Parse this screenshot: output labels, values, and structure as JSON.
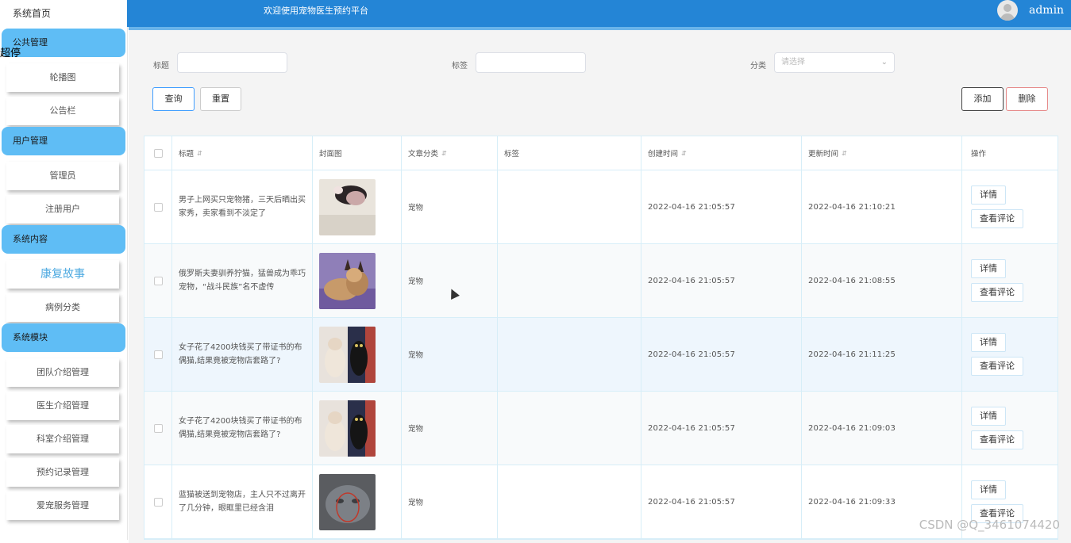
{
  "sidebar": {
    "home": "系统首页",
    "stray_text": "超停",
    "groups": [
      {
        "label": "公共管理",
        "items": [
          "轮播图",
          "公告栏"
        ]
      },
      {
        "label": "用户管理",
        "items": [
          "管理员",
          "注册用户"
        ]
      },
      {
        "label": "系统内容",
        "items": [
          "康复故事",
          "病例分类"
        ]
      },
      {
        "label": "系统模块",
        "items": [
          "团队介绍管理",
          "医生介绍管理",
          "科室介绍管理",
          "预约记录管理",
          "爱宠服务管理"
        ]
      }
    ]
  },
  "header": {
    "title": "欢迎使用宠物医生预约平台",
    "username": "admin"
  },
  "filters": {
    "title_label": "标题",
    "tag_label": "标签",
    "category_label": "分类",
    "category_placeholder": "请选择",
    "query_button": "查询",
    "reset_button": "重置",
    "add_button": "添加",
    "delete_button": "删除"
  },
  "table": {
    "headers": [
      "标题",
      "封面图",
      "文章分类",
      "标签",
      "创建时间",
      "更新时间",
      "操作"
    ],
    "rows": [
      {
        "title": "男子上网买只宠物猪，三天后晒出买家秀，卖家看到不淡定了",
        "category": "宠物",
        "tag": "",
        "created": "2022-04-16 21:05:57",
        "updated": "2022-04-16 21:10:21",
        "thumb": "pig"
      },
      {
        "title": "俄罗斯夫妻驯养狞猫，猛兽成为乖巧宠物，“战斗民族”名不虚传",
        "category": "宠物",
        "tag": "",
        "created": "2022-04-16 21:05:57",
        "updated": "2022-04-16 21:08:55",
        "thumb": "caracal"
      },
      {
        "title": "女子花了4200块钱买了带证书的布偶猫,结果竟被宠物店套路了?",
        "category": "宠物",
        "tag": "",
        "created": "2022-04-16 21:05:57",
        "updated": "2022-04-16 21:11:25",
        "thumb": "ragdoll"
      },
      {
        "title": "女子花了4200块钱买了带证书的布偶猫,结果竟被宠物店套路了?",
        "category": "宠物",
        "tag": "",
        "created": "2022-04-16 21:05:57",
        "updated": "2022-04-16 21:09:03",
        "thumb": "ragdoll"
      },
      {
        "title": "蓝猫被送到宠物店，主人只不过离开了几分钟，眼眶里已经含泪",
        "category": "宠物",
        "tag": "",
        "created": "2022-04-16 21:05:57",
        "updated": "2022-04-16 21:09:33",
        "thumb": "bluecat"
      }
    ],
    "detail_button": "详情",
    "comment_button": "查看评论"
  },
  "watermark": "CSDN @Q_3461074420"
}
